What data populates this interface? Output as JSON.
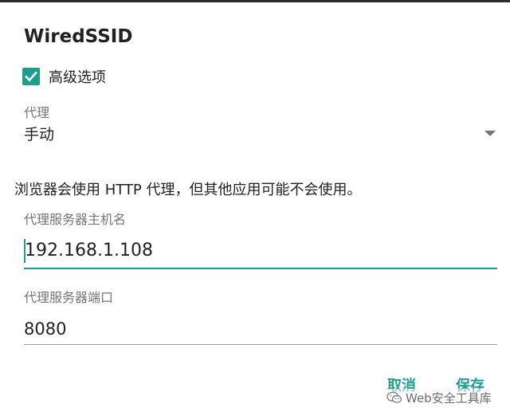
{
  "dialog": {
    "title": "WiredSSID",
    "advanced_options": {
      "label": "高级选项",
      "checked": true
    },
    "proxy": {
      "caption": "代理",
      "selected": "手动"
    },
    "info": "浏览器会使用 HTTP 代理，但其他应用可能不会使用。",
    "hostname": {
      "caption": "代理服务器主机名",
      "value": "192.168.1.108"
    },
    "port": {
      "caption": "代理服务器端口",
      "value": "8080"
    },
    "buttons": {
      "cancel": "取消",
      "save": "保存"
    }
  },
  "watermark": {
    "text": "Web安全工具库",
    "icon": "wechat-icon"
  },
  "colors": {
    "accent": "#1e9e8c",
    "text_primary": "#212121",
    "text_secondary": "#757575"
  }
}
